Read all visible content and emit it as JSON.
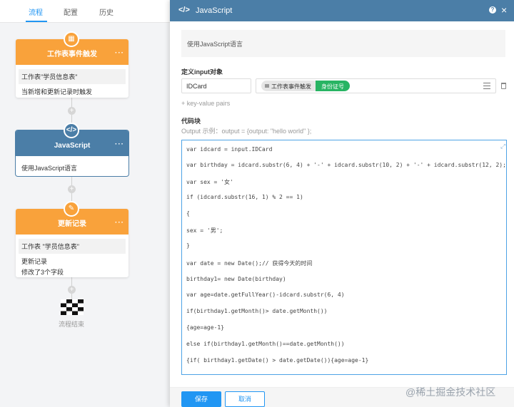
{
  "tabs": [
    "流程",
    "配置",
    "历史"
  ],
  "nodes": {
    "trigger": {
      "title": "工作表事件触发",
      "sub": "工作表\"学员信息表\"",
      "line": "当新增和更新记录时触发"
    },
    "script": {
      "title": "JavaScript",
      "line": "使用JavaScript语言"
    },
    "update": {
      "title": "更新记录",
      "sub": "工作表 \"学员信息表\"",
      "line1": "更新记录",
      "line2": "修改了3个字段"
    },
    "end_label": "流程结束"
  },
  "panel": {
    "title": "JavaScript",
    "description": "使用JavaScript语言",
    "input_section_label": "定义input对象",
    "input_name": "IDCard",
    "tag_source": "工作表事件触发",
    "tag_field": "身份证号",
    "add_kv": "+ key-value pairs",
    "code_section_label": "代码块",
    "hint": "Output 示例：output = {output: \"hello world\" };",
    "code_lines": [
      "var idcard = input.IDCard",
      "var birthday = idcard.substr(6, 4) + '-' + idcard.substr(10, 2) + '-' + idcard.substr(12, 2);",
      "var sex = '女'",
      "if (idcard.substr(16, 1) % 2 == 1)",
      "{",
      "sex = '男';",
      "}",
      "var date = new Date();// 获得今天的时间",
      "birthday1= new Date(birthday)",
      "var age=date.getFullYear()-idcard.substr(6, 4)",
      "if(birthday1.getMonth()> date.getMonth())",
      "{age=age-1}",
      "else if(birthday1.getMonth()==date.getMonth())",
      "{if( birthday1.getDate() > date.getDate()){age=age-1}"
    ],
    "save_label": "保存",
    "cancel_label": "取消"
  },
  "watermark": "@稀土掘金技术社区",
  "colors": {
    "accent": "#2196f3",
    "node_orange": "#f9a23b",
    "node_blue": "#4b7ea7",
    "tag_green": "#28b463"
  }
}
